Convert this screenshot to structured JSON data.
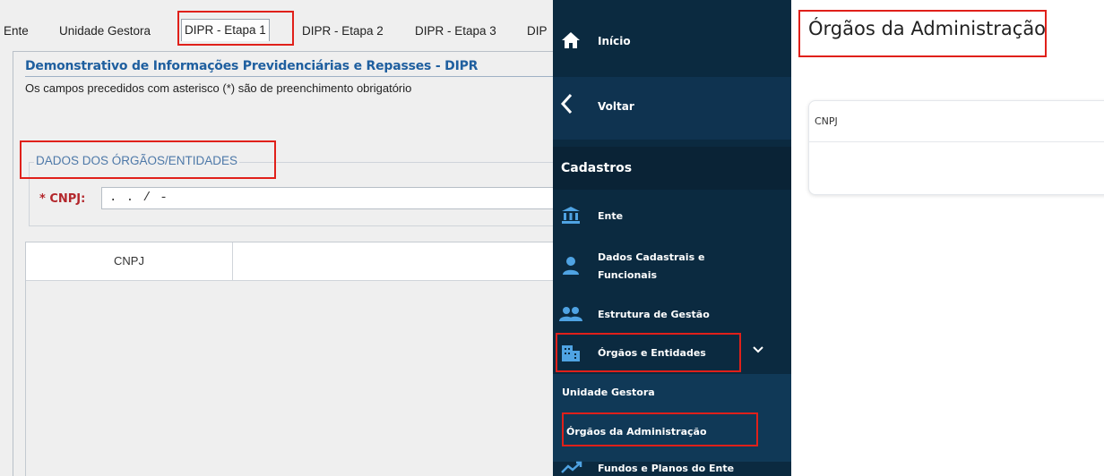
{
  "legacy": {
    "tabs": [
      "Ente",
      "Unidade Gestora",
      "DIPR - Etapa 1",
      "DIPR - Etapa 2",
      "DIPR - Etapa 3",
      "DIP"
    ],
    "active_tab": "DIPR - Etapa 1",
    "title": "Demonstrativo de Informações Previdenciárias e Repasses - DIPR",
    "subtitle": "Os campos precedidos com asterisco (*) são de preenchimento obrigatório",
    "group_label": "DADOS DOS ÓRGÃOS/ENTIDADES",
    "cnpj_label": "* CNPJ:",
    "cnpj_value": " .  .  /  -",
    "grid_columns": [
      "CNPJ",
      ""
    ]
  },
  "sidebar": {
    "inicio": "Início",
    "voltar": "Voltar",
    "section": "Cadastros",
    "items": [
      {
        "label": "Ente",
        "icon": "bank-icon"
      },
      {
        "label": "Dados Cadastrais e Funcionais",
        "icon": "person-icon"
      },
      {
        "label": "Estrutura de Gestão",
        "icon": "people-icon"
      },
      {
        "label": "Órgãos e Entidades",
        "icon": "building-icon",
        "expanded": true
      },
      {
        "label": "Fundos e Planos do Ente",
        "icon": "chart-line-icon"
      }
    ],
    "submenu": [
      "Unidade Gestora",
      "Órgãos da Administração"
    ],
    "active_submenu": "Órgãos da Administração"
  },
  "main": {
    "title": "Órgãos da Administração",
    "card_header": "CNPJ"
  },
  "colors": {
    "sidebar_bg": "#0b2a40",
    "icon_accent": "#4fa3e3",
    "highlight": "#e0201a",
    "legacy_title": "#1f5f9f",
    "required_label": "#b3262b"
  }
}
